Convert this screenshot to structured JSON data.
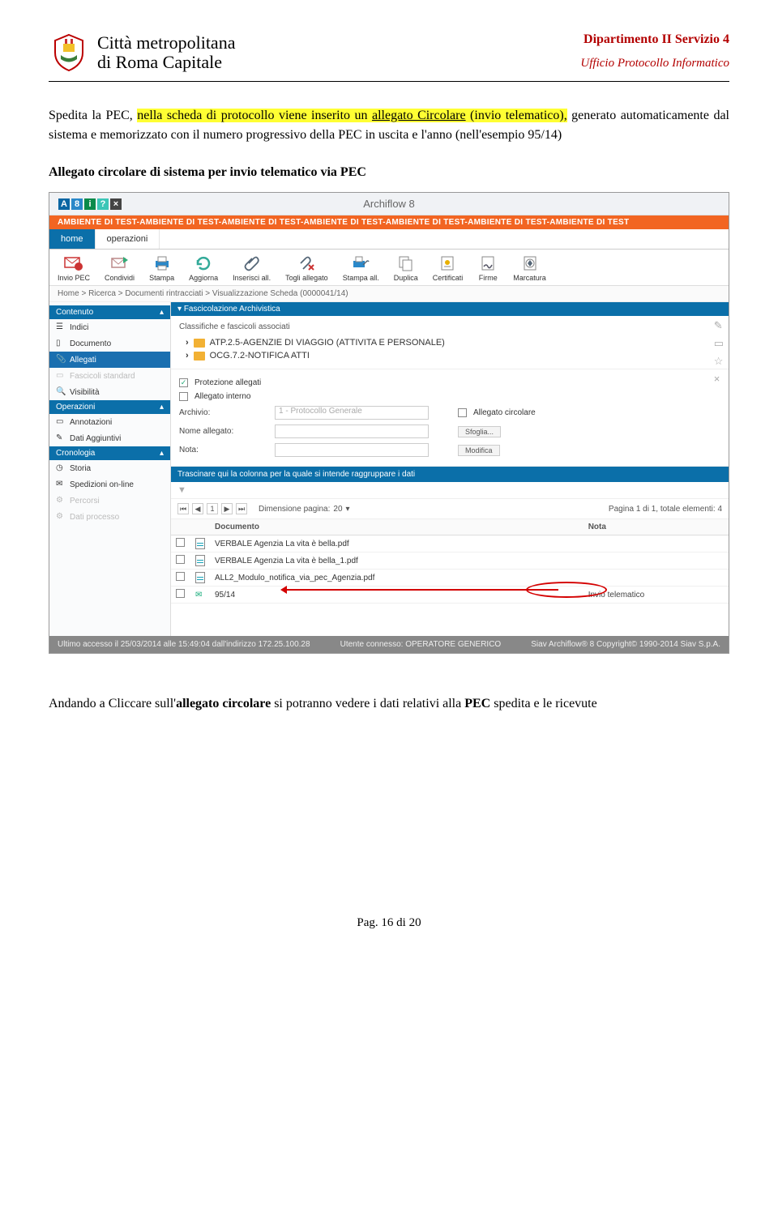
{
  "header": {
    "org_line1": "Città metropolitana",
    "org_line2": "di Roma Capitale",
    "right_line1": "Dipartimento II Servizio 4",
    "right_line2": "Ufficio Protocollo Informatico"
  },
  "body": {
    "p1_pre": "Spedita la PEC, ",
    "p1_hl": "nella scheda di protocollo viene inserito un ",
    "p1_hl_u": "allegato Circolare",
    "p1_hl_post": " (invio telematico),",
    "p1_tail": " generato automaticamente dal sistema e memorizzato con il numero progressivo della PEC in uscita e l'anno (nell'esempio 95/14)",
    "section_title": "Allegato circolare di sistema per invio telematico via PEC",
    "closing_pre": "Andando a Cliccare sull'",
    "closing_bold": "allegato circolare",
    "closing_mid": " si potranno vedere i dati relativi alla ",
    "closing_bold2": "PEC",
    "closing_tail": " spedita e le ricevute"
  },
  "app": {
    "title": "Archiflow 8",
    "logo_chars": [
      "A",
      "8"
    ],
    "orange_banner": "AMBIENTE DI TEST-AMBIENTE DI TEST-AMBIENTE DI TEST-AMBIENTE DI TEST-AMBIENTE DI TEST-AMBIENTE DI TEST-AMBIENTE DI TEST",
    "tabs": {
      "home": "home",
      "operazioni": "operazioni"
    },
    "toolbar": [
      {
        "id": "invio-pec",
        "label": "Invio PEC"
      },
      {
        "id": "condividi",
        "label": "Condividi"
      },
      {
        "id": "stampa",
        "label": "Stampa"
      },
      {
        "id": "aggiorna",
        "label": "Aggiorna"
      },
      {
        "id": "inserisci-all",
        "label": "Inserisci all."
      },
      {
        "id": "togli-allegato",
        "label": "Togli allegato"
      },
      {
        "id": "stampa-all",
        "label": "Stampa all."
      },
      {
        "id": "duplica",
        "label": "Duplica"
      },
      {
        "id": "certificati",
        "label": "Certificati"
      },
      {
        "id": "firme",
        "label": "Firme"
      },
      {
        "id": "marcatura",
        "label": "Marcatura"
      }
    ],
    "breadcrumb": "Home > Ricerca > Documenti rintracciati > Visualizzazione Scheda (0000041/14)",
    "sidebar": {
      "contenuto": "Contenuto",
      "items1": [
        {
          "label": "Indici"
        },
        {
          "label": "Documento"
        },
        {
          "label": "Allegati",
          "sel": true
        },
        {
          "label": "Fascicoli standard",
          "dis": true
        },
        {
          "label": "Visibilità"
        }
      ],
      "operazioni": "Operazioni",
      "items2": [
        {
          "label": "Annotazioni"
        },
        {
          "label": "Dati Aggiuntivi"
        }
      ],
      "cronologia": "Cronologia",
      "items3": [
        {
          "label": "Storia"
        },
        {
          "label": "Spedizioni on-line"
        },
        {
          "label": "Percorsi",
          "dis": true
        },
        {
          "label": "Dati processo",
          "dis": true
        }
      ]
    },
    "main": {
      "collap_title": "Fascicolazione Archivistica",
      "cl_hdr": "Classifiche e fascicoli associati",
      "tree": [
        "ATP.2.5-AGENZIE DI VIAGGIO (ATTIVITA E PERSONALE)",
        "OCG.7.2-NOTIFICA ATTI"
      ],
      "form": {
        "protezione": "Protezione allegati",
        "interno": "Allegato interno",
        "archivio_lbl": "Archivio:",
        "archivio_val": "1 - Protocollo Generale",
        "circolare_lbl": "Allegato circolare",
        "nome_lbl": "Nome allegato:",
        "sfoglia": "Sfoglia...",
        "nota_lbl": "Nota:",
        "modifica": "Modifica"
      },
      "drag_hint": "Trascinare qui la colonna per la quale si intende raggruppare i dati",
      "pager": {
        "dim_lbl": "Dimensione pagina:",
        "dim_val": "20",
        "info": "Pagina 1 di 1, totale elementi: 4",
        "cur": "1"
      },
      "grid": {
        "cols": [
          "",
          "Documento",
          "Nota"
        ],
        "rows": [
          {
            "doc": "VERBALE Agenzia La vita è bella.pdf",
            "nota": ""
          },
          {
            "doc": "VERBALE Agenzia La vita è bella_1.pdf",
            "nota": ""
          },
          {
            "doc": "ALL2_Modulo_notifica_via_pec_Agenzia.pdf",
            "nota": ""
          },
          {
            "doc": "95/14",
            "nota": "Invio telematico",
            "annot": true
          }
        ]
      }
    },
    "status": {
      "left": "Ultimo accesso il 25/03/2014 alle 15:49:04 dall'indirizzo 172.25.100.28",
      "mid": "Utente connesso: OPERATORE GENERICO",
      "right": "Siav Archiflow® 8 Copyright© 1990-2014 Siav S.p.A."
    }
  },
  "footer": {
    "page": "Pag. 16 di 20"
  }
}
